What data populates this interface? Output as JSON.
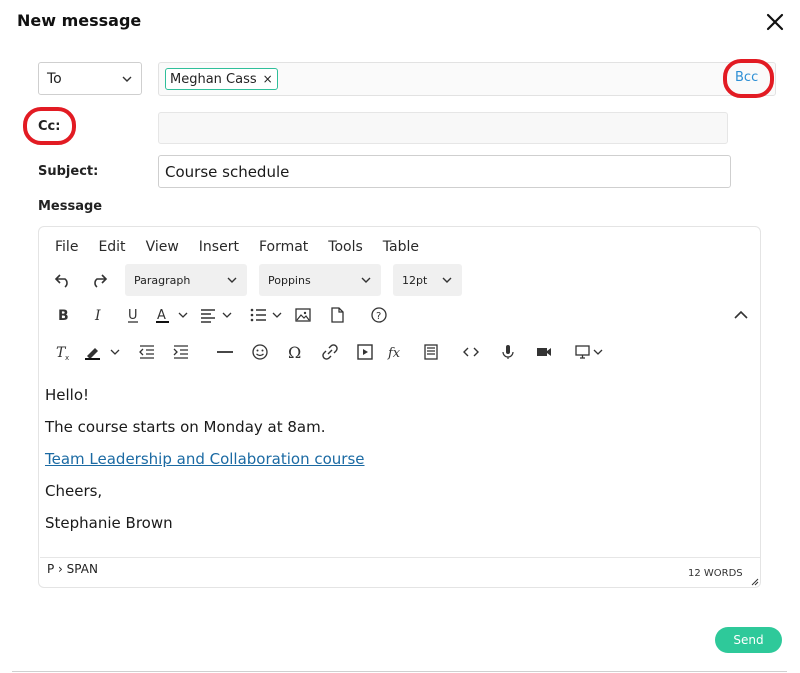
{
  "dialog": {
    "title": "New message"
  },
  "recipients": {
    "type_selected": "To",
    "chips": [
      "Meghan Cass"
    ],
    "chip_remove": "×",
    "bcc_link": "Bcc",
    "cc_label": "Cc:",
    "cc_value": ""
  },
  "subject": {
    "label": "Subject:",
    "value": "Course schedule"
  },
  "message": {
    "label": "Message"
  },
  "editor": {
    "menu": [
      "File",
      "Edit",
      "View",
      "Insert",
      "Format",
      "Tools",
      "Table"
    ],
    "block_format": "Paragraph",
    "font_family": "Poppins",
    "font_size": "12pt",
    "body": {
      "line1": "Hello!",
      "line2": "The course starts on Monday at 8am.",
      "link": "Team Leadership and Collaboration course",
      "line4": "Cheers,",
      "line5": "Stephanie Brown"
    },
    "status_path": "P › SPAN",
    "word_count": "12 WORDS"
  },
  "actions": {
    "send": "Send"
  },
  "colors": {
    "accent": "#2ec99a",
    "highlight_ring": "#e21b23",
    "link": "#1b6aa3",
    "bcc": "#2d8fd5"
  }
}
